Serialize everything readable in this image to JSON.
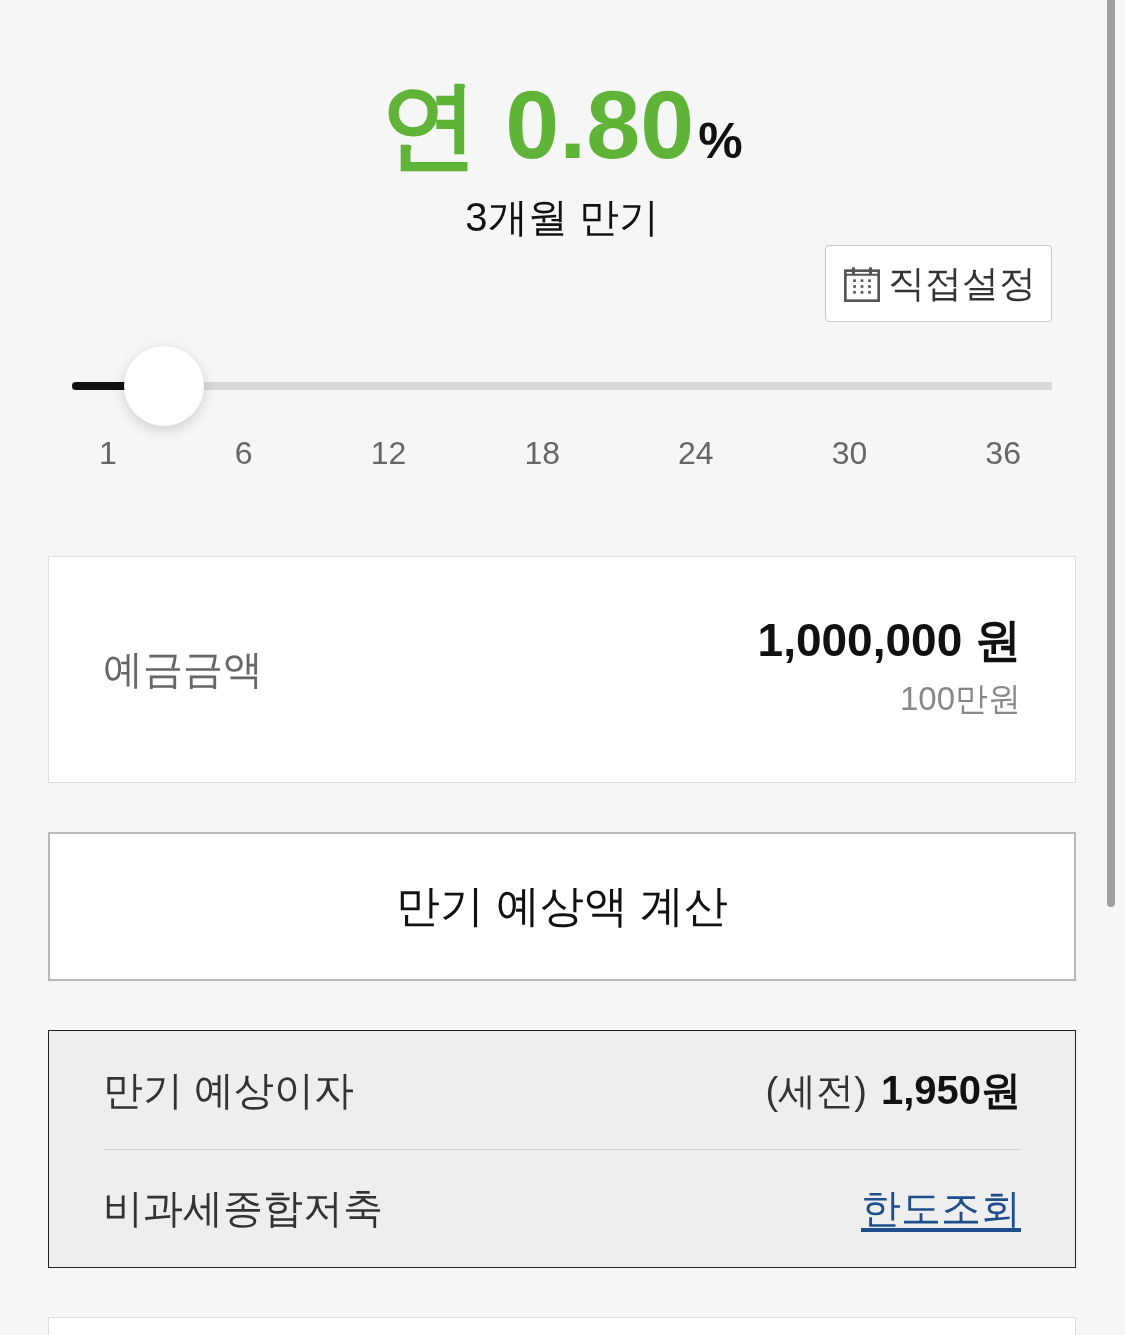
{
  "rate": {
    "text": "연 0.80",
    "unit": "%"
  },
  "term": "3개월 만기",
  "custom_button": {
    "label": "직접설정"
  },
  "slider": {
    "level": 0.094,
    "ticks": [
      "1",
      "6",
      "12",
      "18",
      "24",
      "30",
      "36"
    ]
  },
  "deposit": {
    "label": "예금금액",
    "amount": "1,000,000 원",
    "amount_words": "100만원"
  },
  "calculate_button": {
    "label": "만기 예상액 계산"
  },
  "results": [
    {
      "kind": "value",
      "label": "만기 예상이자",
      "note": "(세전)",
      "value": "1,950원"
    },
    {
      "kind": "link",
      "label": "비과세종합저축",
      "link": "한도조회"
    }
  ]
}
